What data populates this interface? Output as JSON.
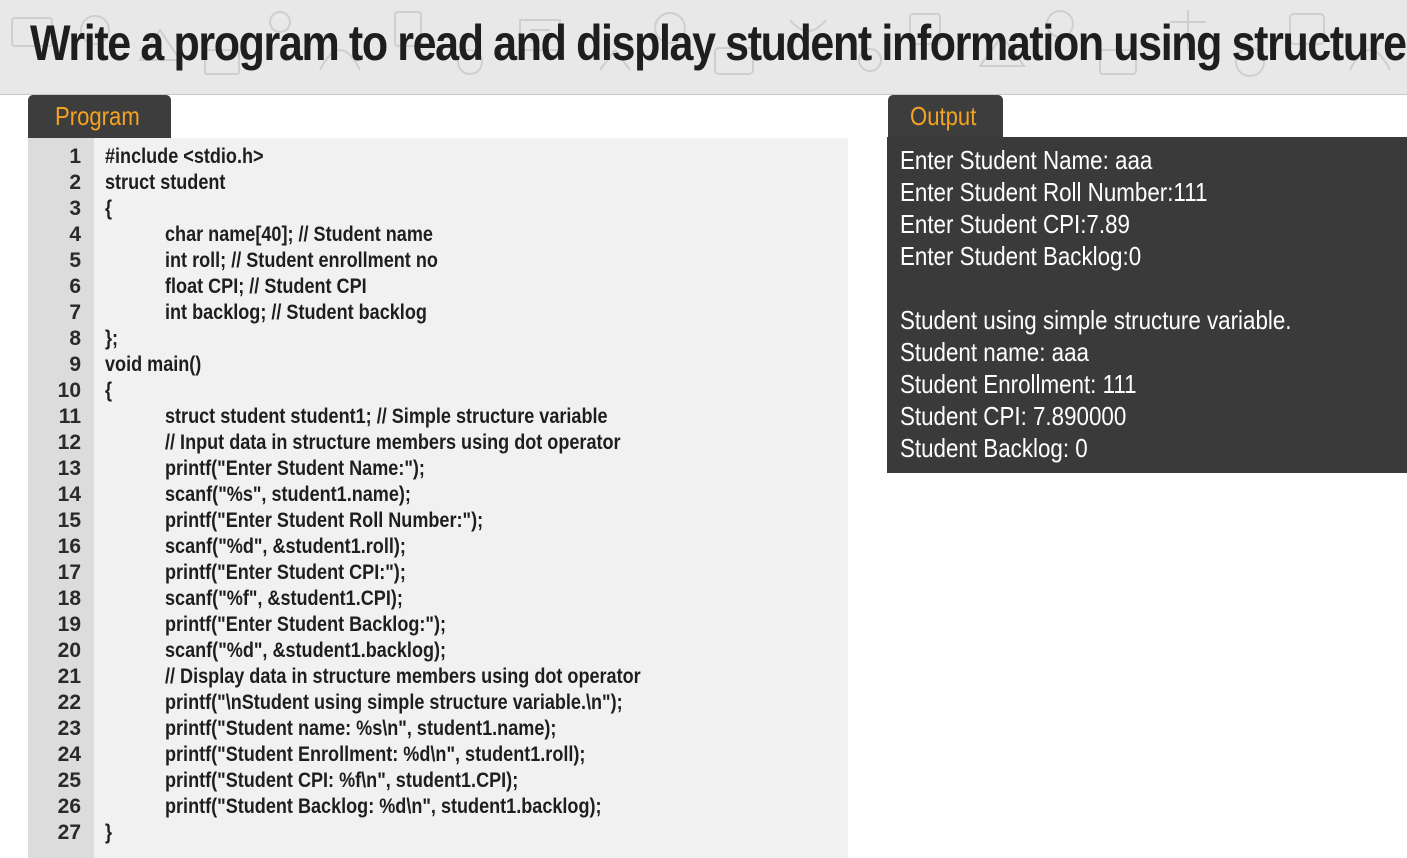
{
  "title": "Write a program to read and display student information using structure",
  "tabs": {
    "program": "Program",
    "output": "Output"
  },
  "program": {
    "lines": [
      {
        "num": "1",
        "text": "#include <stdio.h>",
        "indent": false
      },
      {
        "num": "2",
        "text": "struct student",
        "indent": false
      },
      {
        "num": "3",
        "text": "{",
        "indent": false
      },
      {
        "num": "4",
        "text": "char name[40]; // Student name",
        "indent": true
      },
      {
        "num": "5",
        "text": "int roll; // Student enrollment no",
        "indent": true
      },
      {
        "num": "6",
        "text": "float CPI; // Student CPI",
        "indent": true
      },
      {
        "num": "7",
        "text": "int backlog; // Student backlog",
        "indent": true
      },
      {
        "num": "8",
        "text": "};",
        "indent": false
      },
      {
        "num": "9",
        "text": "void main()",
        "indent": false
      },
      {
        "num": "10",
        "text": "{",
        "indent": false
      },
      {
        "num": "11",
        "text": "struct student student1; // Simple structure variable",
        "indent": true
      },
      {
        "num": "12",
        "text": "// Input data in structure members using dot operator",
        "indent": true
      },
      {
        "num": "13",
        "text": "printf(\"Enter Student Name:\");",
        "indent": true
      },
      {
        "num": "14",
        "text": "scanf(\"%s\", student1.name);",
        "indent": true
      },
      {
        "num": "15",
        "text": "printf(\"Enter Student Roll Number:\");",
        "indent": true
      },
      {
        "num": "16",
        "text": "scanf(\"%d\", &student1.roll);",
        "indent": true
      },
      {
        "num": "17",
        "text": "printf(\"Enter Student CPI:\");",
        "indent": true
      },
      {
        "num": "18",
        "text": "scanf(\"%f\", &student1.CPI);",
        "indent": true
      },
      {
        "num": "19",
        "text": "printf(\"Enter Student Backlog:\");",
        "indent": true
      },
      {
        "num": "20",
        "text": "scanf(\"%d\", &student1.backlog);",
        "indent": true
      },
      {
        "num": "21",
        "text": "// Display data in structure members using dot operator",
        "indent": true
      },
      {
        "num": "22",
        "text": "printf(\"\\nStudent using simple structure variable.\\n\");",
        "indent": true
      },
      {
        "num": "23",
        "text": "printf(\"Student name: %s\\n\", student1.name);",
        "indent": true
      },
      {
        "num": "24",
        "text": "printf(\"Student Enrollment: %d\\n\", student1.roll);",
        "indent": true
      },
      {
        "num": "25",
        "text": "printf(\"Student CPI: %f\\n\", student1.CPI);",
        "indent": true
      },
      {
        "num": "26",
        "text": "printf(\"Student Backlog: %d\\n\", student1.backlog);",
        "indent": true
      },
      {
        "num": "27",
        "text": "}",
        "indent": false
      }
    ]
  },
  "output": {
    "lines": [
      "Enter Student Name: aaa",
      "Enter Student Roll Number:111",
      "Enter Student CPI:7.89",
      "Enter Student Backlog:0",
      "",
      "Student using simple structure variable.",
      "Student name: aaa",
      "Student Enrollment: 111",
      "Student CPI: 7.890000",
      "Student Backlog: 0"
    ]
  },
  "colors": {
    "title_bg": "#e8e8e8",
    "tab_bg": "#3d3d3d",
    "tab_text": "#f4a221",
    "code_bg": "#f1f1f1",
    "gutter_bg": "#dcdcdc",
    "output_bg": "#3a3a3a",
    "output_text": "#ffffff"
  }
}
